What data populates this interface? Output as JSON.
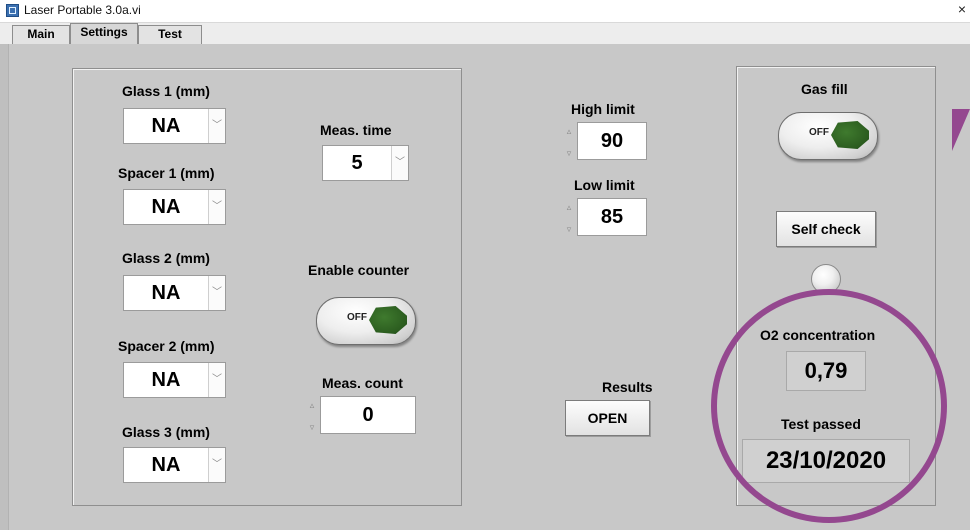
{
  "window": {
    "title": "Laser Portable 3.0a.vi",
    "close_glyph": "×"
  },
  "tabs": [
    {
      "label": "Main"
    },
    {
      "label": "Settings",
      "active": true
    },
    {
      "label": "Test"
    }
  ],
  "settings": {
    "glass1": {
      "label": "Glass 1 (mm)",
      "value": "NA"
    },
    "spacer1": {
      "label": "Spacer 1 (mm)",
      "value": "NA"
    },
    "glass2": {
      "label": "Glass 2 (mm)",
      "value": "NA"
    },
    "spacer2": {
      "label": "Spacer 2 (mm)",
      "value": "NA"
    },
    "glass3": {
      "label": "Glass 3 (mm)",
      "value": "NA"
    },
    "meas_time": {
      "label": "Meas. time",
      "value": "5"
    },
    "enable_counter": {
      "label": "Enable counter",
      "state": "OFF"
    },
    "meas_count": {
      "label": "Meas. count",
      "value": "0"
    }
  },
  "limits": {
    "high": {
      "label": "High limit",
      "value": "90"
    },
    "low": {
      "label": "Low limit",
      "value": "85"
    }
  },
  "results": {
    "label": "Results",
    "button": "OPEN"
  },
  "right_panel": {
    "gas_fill": {
      "label": "Gas fill",
      "state": "OFF"
    },
    "self_check": {
      "label": "Self check"
    },
    "o2": {
      "label": "O2 concentration",
      "value": "0,79"
    },
    "test_passed": {
      "label": "Test passed",
      "value": "23/10/2020"
    }
  },
  "icons": {
    "dropdown_arrow": "﹀",
    "spin_up": "▵",
    "spin_down": "▿"
  },
  "colors": {
    "panel_bg": "#c8c8c8",
    "annotation": "#94488f",
    "toggle_green": "#2b5c1f"
  }
}
